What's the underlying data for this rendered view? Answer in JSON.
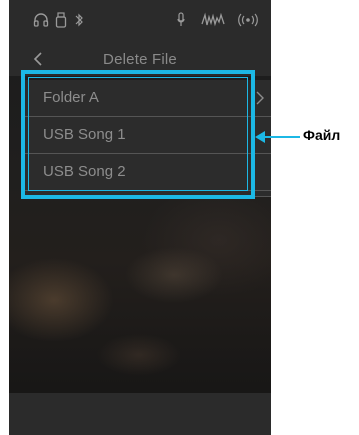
{
  "screen": {
    "title": "Delete File",
    "status_icons": [
      "headphones-icon",
      "usb-memory-icon",
      "bluetooth-icon",
      "microphone-icon",
      "sound-wave-icon",
      "wireless-icon"
    ]
  },
  "file_list": {
    "items": [
      {
        "label": "Folder A",
        "type": "folder"
      },
      {
        "label": "USB Song 1",
        "type": "file"
      },
      {
        "label": "USB Song 2",
        "type": "file"
      }
    ]
  },
  "callout": {
    "label": "Файл"
  },
  "colors": {
    "highlight": "#1cb8e5",
    "bar_bg": "#2b2b2b",
    "text": "#8d8d8d"
  }
}
